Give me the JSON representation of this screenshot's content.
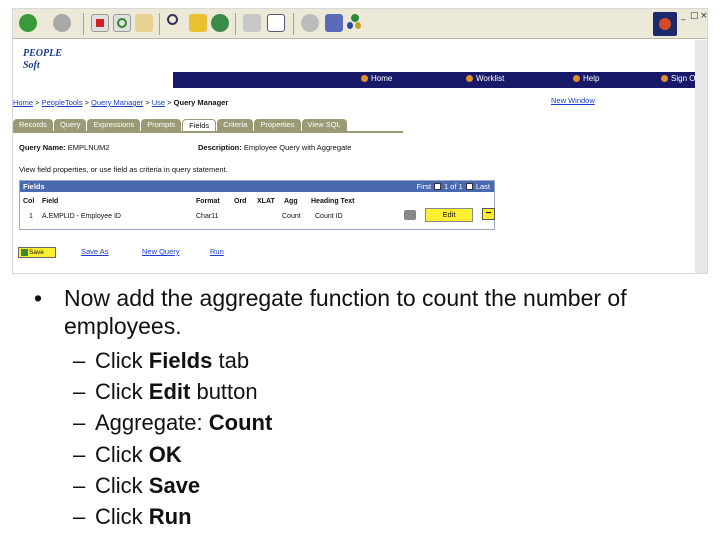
{
  "browser": {
    "icons": [
      "back-icon",
      "forward-icon",
      "stop-icon",
      "refresh-icon",
      "home-icon",
      "search-icon",
      "favorites-icon",
      "history-icon",
      "print-icon",
      "edit-icon",
      "messenger-icon",
      "discuss-icon",
      "related-icon"
    ],
    "window_controls": [
      "_",
      "□",
      "×"
    ]
  },
  "app": {
    "logo": "PEOPLE Soft",
    "nav": {
      "home": "Home",
      "worklist": "Worklist",
      "help": "Help",
      "signout": "Sign Out"
    }
  },
  "breadcrumb": {
    "home": "Home",
    "sep1": ">",
    "peopletools": "PeopleTools",
    "sep2": ">",
    "qm": "Query Manager",
    "sep3": ">",
    "use": "Use",
    "sep4": ">",
    "current": "Query Manager"
  },
  "new_window": "New Window",
  "tabs": [
    "Records",
    "Query",
    "Expressions",
    "Prompts",
    "Fields",
    "Criteria",
    "Properties",
    "View SQL"
  ],
  "active_tab": "Fields",
  "query": {
    "name_label": "Query Name:",
    "name": "EMPLNUM2",
    "desc_label": "Description:",
    "desc": "Employee Query with Aggregate"
  },
  "hint": "View field properties, or use field as criteria in query statement.",
  "grid": {
    "title": "Fields",
    "nav": {
      "first": "First",
      "count": "1 of 1",
      "last": "Last"
    },
    "columns": [
      "Col",
      "Field",
      "Format",
      "Ord",
      "XLAT",
      "Agg",
      "Heading Text"
    ],
    "row": {
      "col": "1",
      "field": "A.EMPLID - Employee ID",
      "format": "Char11",
      "ord": "",
      "xlat": "",
      "agg": "Count",
      "heading": "Count ID"
    },
    "edit": "Edit",
    "minus": "−"
  },
  "actions": {
    "save": "Save",
    "save_as": "Save As",
    "new_query": "New Query",
    "run": "Run"
  },
  "slide": {
    "bullet": "•",
    "main": "Now add the aggregate function to count the number of employees.",
    "steps": [
      {
        "pre": "Click ",
        "bold": "Fields",
        "post": " tab"
      },
      {
        "pre": "Click ",
        "bold": "Edit",
        "post": " button"
      },
      {
        "pre": "Aggregate: ",
        "bold": "Count",
        "post": ""
      },
      {
        "pre": "Click ",
        "bold": "OK",
        "post": ""
      },
      {
        "pre": "Click ",
        "bold": "Save",
        "post": ""
      },
      {
        "pre": "Click ",
        "bold": "Run",
        "post": ""
      }
    ],
    "dash": "–"
  },
  "colors": {
    "nav_bar": "#19196a",
    "tab": "#9a9a76",
    "grid_header": "#4a6ab0",
    "button": "#ffef33",
    "link": "#1a3cc8"
  }
}
